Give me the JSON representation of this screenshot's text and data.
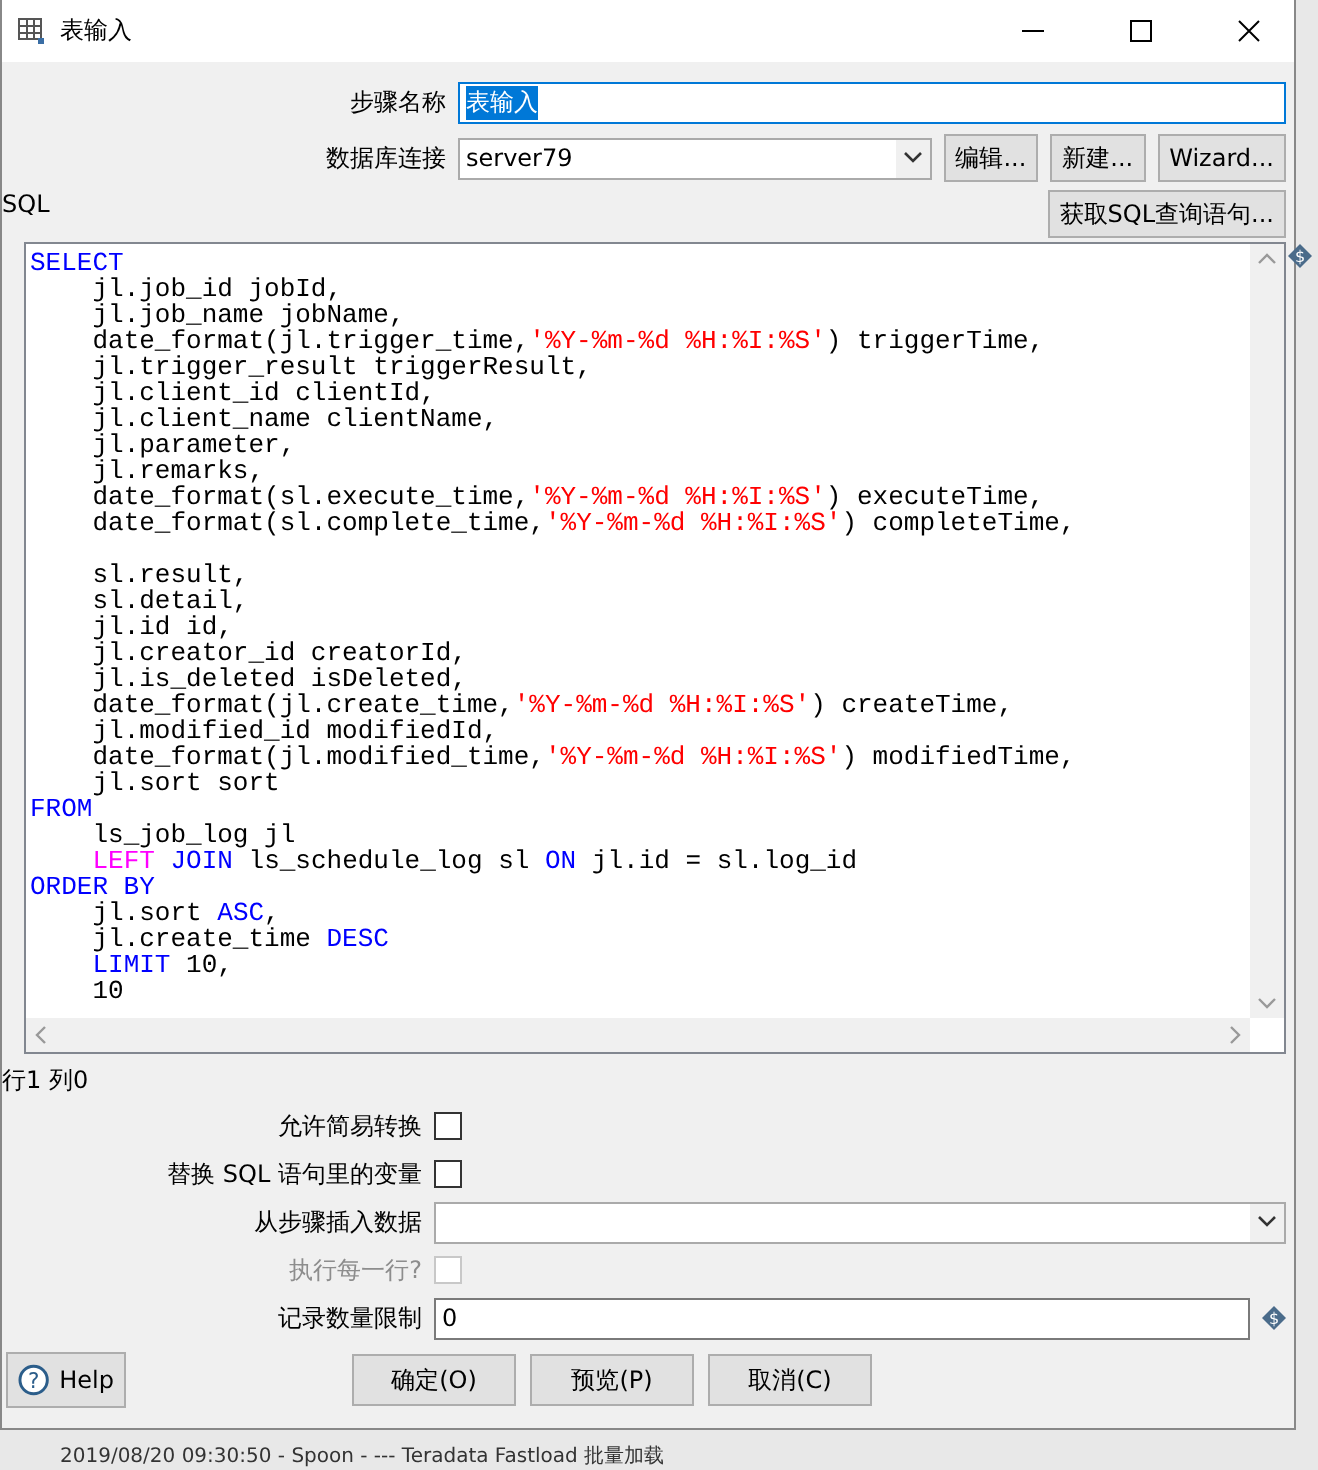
{
  "window": {
    "title": "表输入"
  },
  "step_name": {
    "label": "步骤名称",
    "value": "表输入"
  },
  "connection": {
    "label": "数据库连接",
    "value": "server79",
    "buttons": [
      "编辑...",
      "新建...",
      "Wizard..."
    ]
  },
  "sql_label": "SQL",
  "get_sql_button": "获取SQL查询语句...",
  "sql_lines": [
    {
      "indent": false,
      "tokens": [
        {
          "kind": "keyword",
          "text": "SELECT"
        }
      ]
    },
    {
      "indent": true,
      "tokens": [
        {
          "kind": "plain",
          "text": "jl.job_id jobId,"
        }
      ]
    },
    {
      "indent": true,
      "tokens": [
        {
          "kind": "plain",
          "text": "jl.job_name jobName,"
        }
      ]
    },
    {
      "indent": true,
      "tokens": [
        {
          "kind": "plain",
          "text": "date_format(jl.trigger_time,"
        },
        {
          "kind": "string",
          "text": "'%Y-%m-%d %H:%I:%S'"
        },
        {
          "kind": "plain",
          "text": ") triggerTime,"
        }
      ]
    },
    {
      "indent": true,
      "tokens": [
        {
          "kind": "plain",
          "text": "jl.trigger_result triggerResult,"
        }
      ]
    },
    {
      "indent": true,
      "tokens": [
        {
          "kind": "plain",
          "text": "jl.client_id clientId,"
        }
      ]
    },
    {
      "indent": true,
      "tokens": [
        {
          "kind": "plain",
          "text": "jl.client_name clientName,"
        }
      ]
    },
    {
      "indent": true,
      "tokens": [
        {
          "kind": "plain",
          "text": "jl.parameter,"
        }
      ]
    },
    {
      "indent": true,
      "tokens": [
        {
          "kind": "plain",
          "text": "jl.remarks,"
        }
      ]
    },
    {
      "indent": true,
      "tokens": [
        {
          "kind": "plain",
          "text": "date_format(sl.execute_time,"
        },
        {
          "kind": "string",
          "text": "'%Y-%m-%d %H:%I:%S'"
        },
        {
          "kind": "plain",
          "text": ") executeTime,"
        }
      ]
    },
    {
      "indent": true,
      "tokens": [
        {
          "kind": "plain",
          "text": "date_format(sl.complete_time,"
        },
        {
          "kind": "string",
          "text": "'%Y-%m-%d %H:%I:%S'"
        },
        {
          "kind": "plain",
          "text": ") completeTime,"
        }
      ]
    },
    {
      "indent": true,
      "gap_before": true,
      "tokens": [
        {
          "kind": "plain",
          "text": "sl.result,"
        }
      ]
    },
    {
      "indent": true,
      "tokens": [
        {
          "kind": "plain",
          "text": "sl.detail,"
        }
      ]
    },
    {
      "indent": true,
      "tokens": [
        {
          "kind": "plain",
          "text": "jl.id id,"
        }
      ]
    },
    {
      "indent": true,
      "tokens": [
        {
          "kind": "plain",
          "text": "jl.creator_id creatorId,"
        }
      ]
    },
    {
      "indent": true,
      "tokens": [
        {
          "kind": "plain",
          "text": "jl.is_deleted isDeleted,"
        }
      ]
    },
    {
      "indent": true,
      "tokens": [
        {
          "kind": "plain",
          "text": "date_format(jl.create_time,"
        },
        {
          "kind": "string",
          "text": "'%Y-%m-%d %H:%I:%S'"
        },
        {
          "kind": "plain",
          "text": ") createTime,"
        }
      ]
    },
    {
      "indent": true,
      "tokens": [
        {
          "kind": "plain",
          "text": "jl.modified_id modifiedId,"
        }
      ]
    },
    {
      "indent": true,
      "tokens": [
        {
          "kind": "plain",
          "text": "date_format(jl.modified_time,"
        },
        {
          "kind": "string",
          "text": "'%Y-%m-%d %H:%I:%S'"
        },
        {
          "kind": "plain",
          "text": ") modifiedTime,"
        }
      ]
    },
    {
      "indent": true,
      "tokens": [
        {
          "kind": "plain",
          "text": "jl.sort sort"
        }
      ]
    },
    {
      "indent": false,
      "tokens": [
        {
          "kind": "keyword",
          "text": "FROM"
        }
      ]
    },
    {
      "indent": true,
      "tokens": [
        {
          "kind": "plain",
          "text": "ls_job_log jl"
        }
      ]
    },
    {
      "indent": true,
      "tokens": [
        {
          "kind": "join",
          "text": "LEFT"
        },
        {
          "kind": "keyword",
          "text": "JOIN"
        },
        {
          "kind": "plain",
          "text": " ls_schedule_log sl "
        },
        {
          "kind": "keyword",
          "text": "ON"
        },
        {
          "kind": "plain",
          "text": " jl.id = sl.log_id"
        }
      ]
    },
    {
      "indent": false,
      "tokens": [
        {
          "kind": "keyword",
          "text": "ORDER BY"
        }
      ]
    },
    {
      "indent": true,
      "tokens": [
        {
          "kind": "plain",
          "text": "jl.sort "
        },
        {
          "kind": "keyword",
          "text": "ASC"
        },
        {
          "kind": "plain",
          "text": ","
        }
      ]
    },
    {
      "indent": true,
      "tokens": [
        {
          "kind": "plain",
          "text": "jl.create_time "
        },
        {
          "kind": "keyword",
          "text": "DESC"
        }
      ]
    },
    {
      "indent": true,
      "tokens": [
        {
          "kind": "keyword",
          "text": "LIMIT"
        },
        {
          "kind": "plain",
          "text": " 10,"
        }
      ]
    },
    {
      "indent": true,
      "tokens": [
        {
          "kind": "plain",
          "text": "10"
        }
      ]
    }
  ],
  "cursor_position": "行1 列0",
  "options": [
    {
      "kind": "checkbox",
      "label": "允许简易转换",
      "checked": false,
      "disabled": false
    },
    {
      "kind": "checkbox",
      "label": "替换 SQL 语句里的变量",
      "checked": false,
      "disabled": false
    },
    {
      "kind": "dropdown",
      "label": "从步骤插入数据"
    },
    {
      "kind": "checkbox",
      "label": "执行每一行?",
      "checked": false,
      "disabled": true
    },
    {
      "kind": "text",
      "label": "记录数量限制",
      "value": "0"
    }
  ],
  "help_button": "Help",
  "help_icon": "?",
  "sql_variable_marker": "$",
  "limit_variable_marker": "$",
  "buttons": [
    "确定(O)",
    "预览(P)",
    "取消(C)"
  ],
  "background_log": "2019/08/20 09:30:50 - Spoon - --- Teradata Fastload 批量加载"
}
